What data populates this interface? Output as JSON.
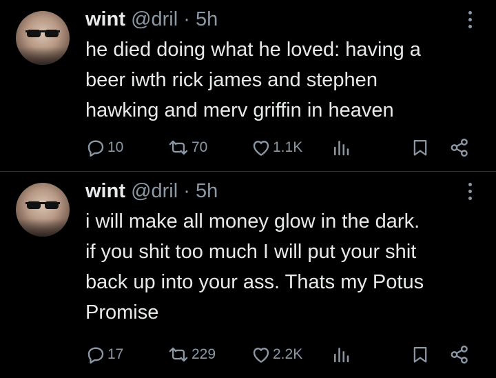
{
  "tweets": [
    {
      "author": {
        "name": "wint",
        "handle": "@dril"
      },
      "separator": "·",
      "time": "5h",
      "text": "he died doing what he loved: having a\nbeer iwth rick james and stephen\nhawking and merv griffin in heaven",
      "stats": {
        "replies": "10",
        "retweets": "70",
        "likes": "1.1K"
      }
    },
    {
      "author": {
        "name": "wint",
        "handle": "@dril"
      },
      "separator": "·",
      "time": "5h",
      "text": "i will make all money glow in the dark.\nif you shit too much I will put your shit\nback up into your ass. Thats my Potus\nPromise",
      "stats": {
        "replies": "17",
        "retweets": "229",
        "likes": "2.2K"
      }
    }
  ],
  "icons": {
    "reply": "reply-icon",
    "retweet": "retweet-icon",
    "like": "heart-icon",
    "views": "views-icon",
    "bookmark": "bookmark-icon",
    "share": "share-icon",
    "more": "more-options-icon"
  },
  "colors": {
    "background": "#000000",
    "text": "#e7e9ea",
    "muted": "#8b98a5",
    "divider": "#2f3336"
  }
}
